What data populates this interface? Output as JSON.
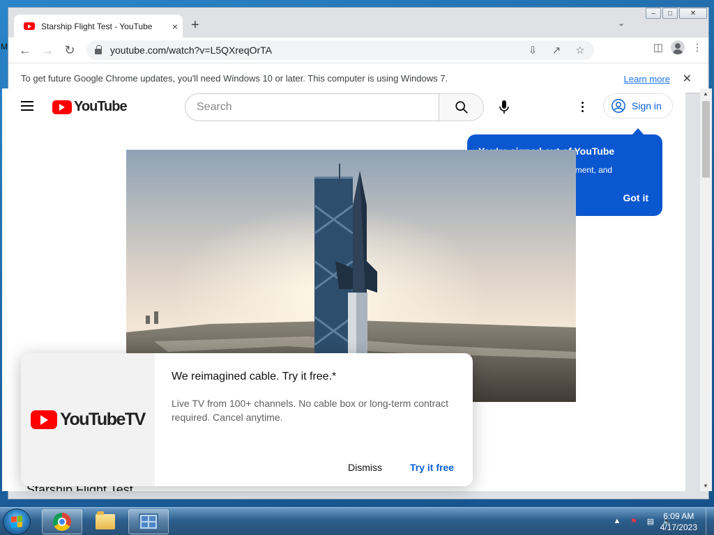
{
  "desktop": {
    "edge_letter": "M"
  },
  "window": {
    "caption_buttons": [
      "minimize",
      "maximize",
      "close"
    ]
  },
  "tab": {
    "title": "Starship Flight Test - YouTube",
    "close_glyph": "×"
  },
  "newtab_glyph": "+",
  "toolbar": {
    "url": "youtube.com/watch?v=L5QXreqOrTA"
  },
  "infobar": {
    "text": "To get future Google Chrome updates, you'll need Windows 10 or later. This computer is using Windows 7.",
    "link": "Learn more",
    "close_glyph": "✕"
  },
  "youtube": {
    "logo_text": "YouTube",
    "search_placeholder": "Search",
    "signin_label": "Sign in",
    "popover": {
      "title": "You're signed out of YouTube",
      "body": "Sign in to like videos, comment, and subscribe.",
      "button": "Got it"
    },
    "video_title": "Starship Flight Test"
  },
  "promo": {
    "logo_text": "YouTubeTV",
    "title": "We reimagined cable. Try it free.*",
    "body": "Live TV from 100+ channels. No cable box or long-term contract required. Cancel anytime.",
    "dismiss": "Dismiss",
    "try": "Try it free"
  },
  "taskbar": {
    "time": "6:09 AM",
    "date": "4/17/2023",
    "pinned": [
      "chrome",
      "windows-explorer",
      "control-panel"
    ]
  },
  "colors": {
    "youtube_red": "#ff0000",
    "popover_blue": "#0b57d0",
    "link_blue": "#065fd4"
  }
}
